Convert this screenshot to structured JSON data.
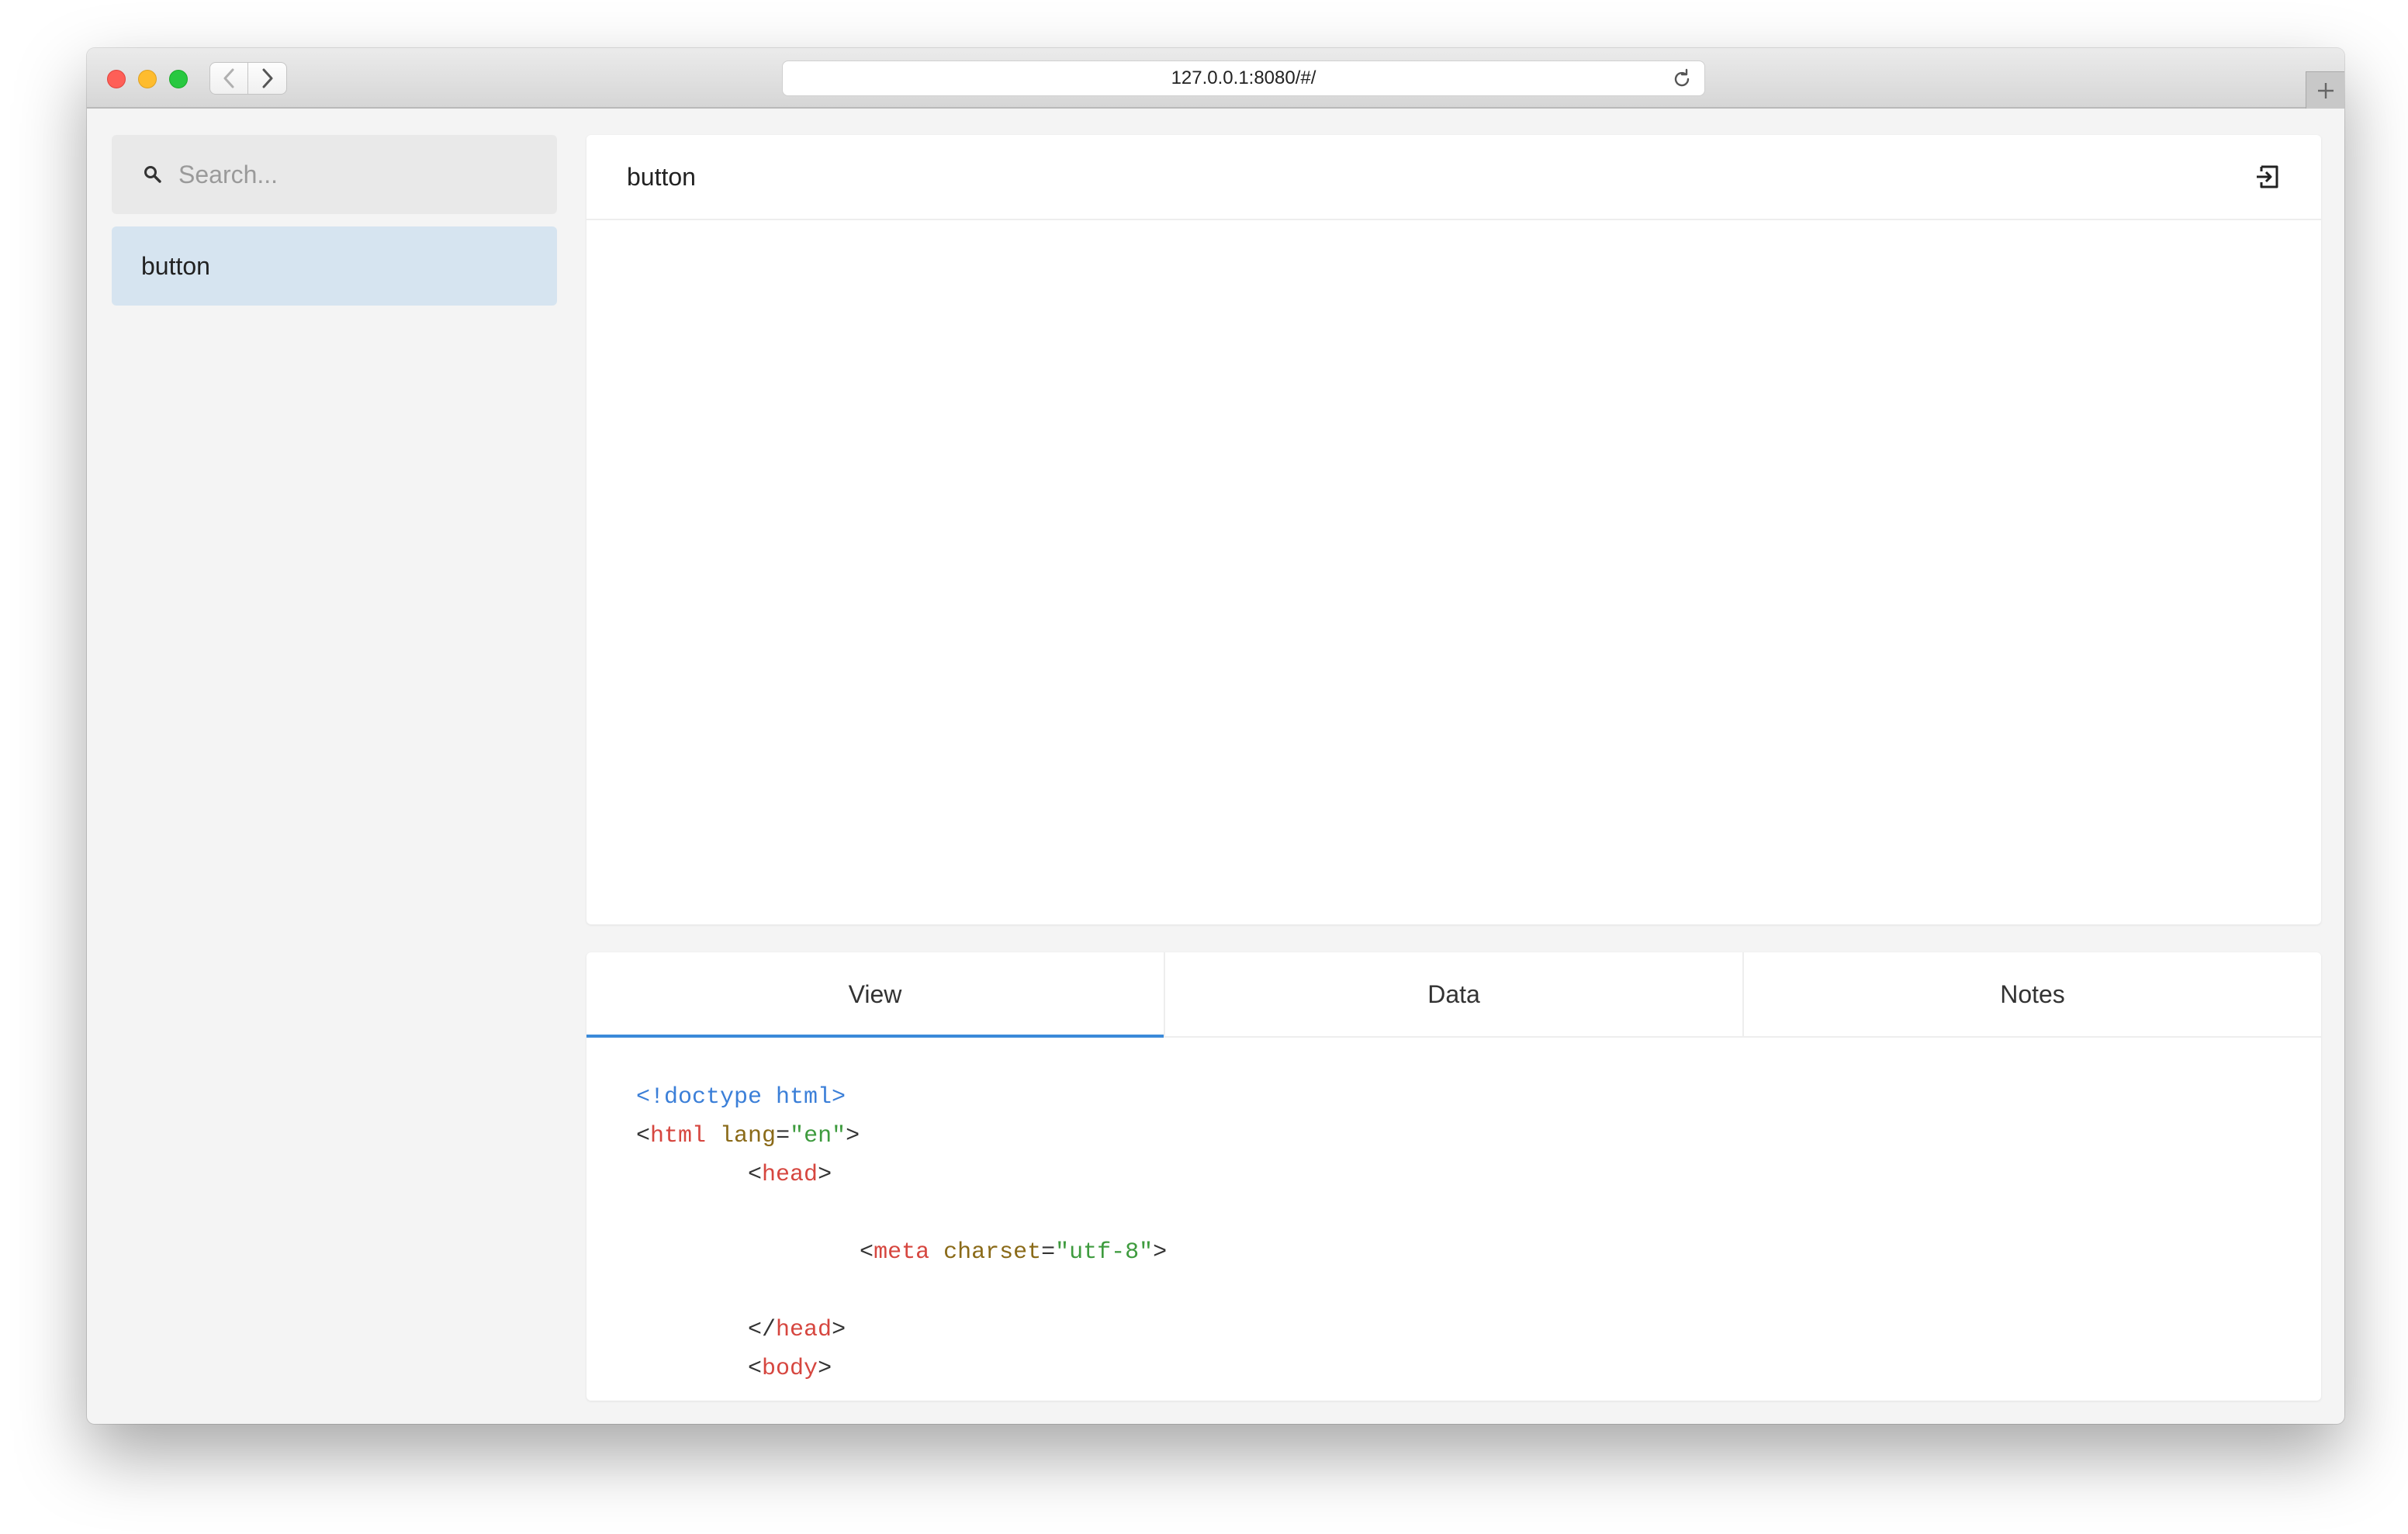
{
  "browser": {
    "url": "127.0.0.1:8080/#/"
  },
  "sidebar": {
    "search_placeholder": "Search...",
    "items": [
      {
        "label": "button",
        "selected": true
      }
    ]
  },
  "preview": {
    "title": "button"
  },
  "tabs": [
    {
      "label": "View",
      "active": true
    },
    {
      "label": "Data",
      "active": false
    },
    {
      "label": "Notes",
      "active": false
    }
  ],
  "code": {
    "doctype": "<!doctype html>",
    "lt": "<",
    "gt": ">",
    "lt_slash": "</",
    "eq": "=",
    "html_tag": "html",
    "lang_attr": "lang",
    "lang_val": "\"en\"",
    "head_tag": "head",
    "meta_tag": "meta",
    "charset_attr": "charset",
    "charset_val": "\"utf-8\"",
    "body_tag": "body"
  },
  "colors": {
    "accent": "#3b8ad9",
    "selected_item_bg": "#d6e4f0",
    "code_tag": "#d6463f",
    "code_attr": "#8a6a18",
    "code_string": "#3e9b3e",
    "code_doctype": "#3b7fd8"
  }
}
